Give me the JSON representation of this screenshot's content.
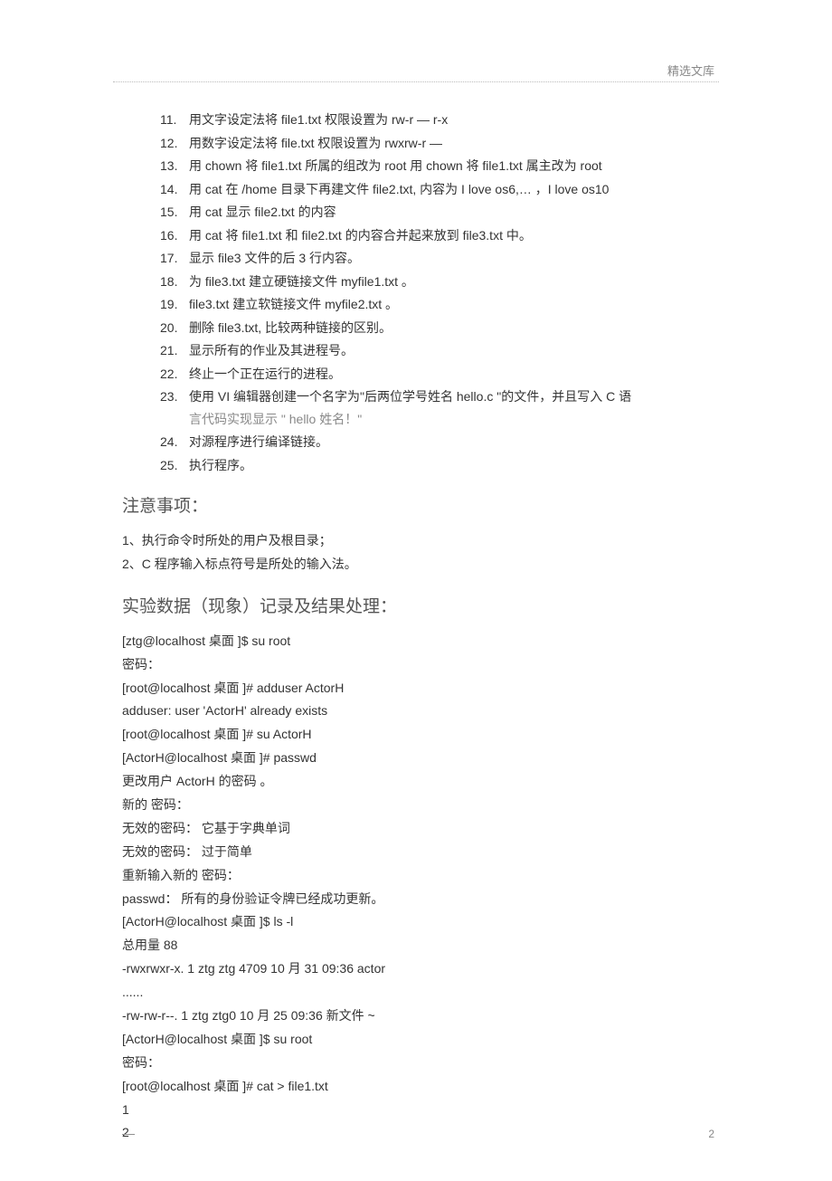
{
  "header": {
    "label": "精选文库"
  },
  "list": {
    "items": [
      {
        "n": "11.",
        "t": "用文字设定法将   file1.txt 权限设置为  rw-r — r-x"
      },
      {
        "n": "12.",
        "t": "用数字设定法将   file.txt 权限设置为  rwxrw-r —"
      },
      {
        "n": "13.",
        "t": "用 chown 将 file1.txt 所属的组改为  root 用 chown 将 file1.txt 属主改为  root"
      },
      {
        "n": "14.",
        "t": "用 cat 在 /home 目录下再建文件   file2.txt, 内容为  I love os6,… ，I love os10"
      },
      {
        "n": "15.",
        "t": "用 cat 显示 file2.txt 的内容"
      },
      {
        "n": "16.",
        "t": "用 cat 将 file1.txt 和 file2.txt 的内容合并起来放到        file3.txt 中。"
      },
      {
        "n": "17.",
        "t": "显示 file3 文件的后  3 行内容。"
      },
      {
        "n": "18.",
        "t": "为 file3.txt 建立硬链接文件      myfile1.txt 。"
      },
      {
        "n": "19.",
        "t": "file3.txt 建立软链接文件   myfile2.txt 。"
      },
      {
        "n": "20.",
        "t": "删除 file3.txt, 比较两种链接的区别。"
      },
      {
        "n": "21.",
        "t": "显示所有的作业及其进程号。"
      },
      {
        "n": "22.",
        "t": "终止一个正在运行的进程。"
      },
      {
        "n": "23.",
        "t": "使用 VI 编辑器创建一个名字为\"后两位学号姓名           hello.c \"的文件，并且写入      C 语",
        "sub": "言代码实现显示    \" hello  姓名！\""
      },
      {
        "n": "24.",
        "t": "对源程序进行编译链接。"
      },
      {
        "n": "25.",
        "t": "执行程序。"
      }
    ]
  },
  "section1": {
    "title": "注意事项：",
    "lines": [
      "1、执行命令时所处的用户及根目录；",
      "2、C 程序输入标点符号是所处的输入法。"
    ]
  },
  "section2": {
    "title": "实验数据（现象）记录及结果处理：",
    "lines": [
      "[ztg@localhost  桌面 ]$ su root",
      "密码：",
      "[root@localhost  桌面 ]# adduser ActorH",
      "adduser: user 'ActorH' already exists",
      "[root@localhost   桌面 ]# su ActorH",
      "[ActorH@localhost   桌面 ]# passwd",
      "更改用户 ActorH    的密码 。",
      "新的  密码：",
      "无效的密码：     它基于字典单词",
      "无效的密码：     过于简单",
      "重新输入新的    密码：",
      "passwd： 所有的身份验证令牌已经成功更新。",
      "[ActorH@localhost   桌面 ]$ ls -l",
      "总用量  88",
      "-rwxrwxr-x.     1 ztg ztg 4709 10 月  31 09:36 actor",
      "......",
      "-rw-rw-r--.     1 ztg ztg0 10 月  25 09:36         新文件 ~",
      "[ActorH@localhost   桌面 ]$ su root",
      "密码：",
      "[root@localhost   桌面 ]# cat > file1.txt",
      "1",
      "2"
    ]
  },
  "footer": {
    "page": "2",
    "dash": "—"
  }
}
